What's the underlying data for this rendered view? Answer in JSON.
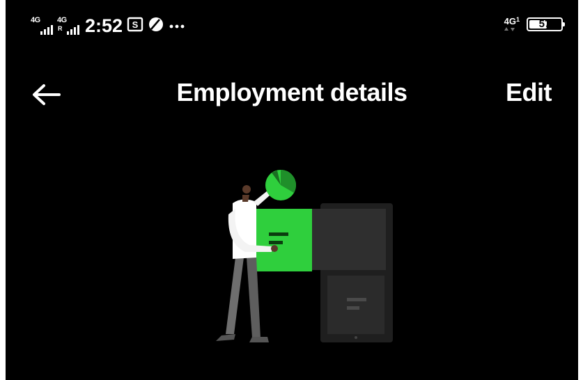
{
  "status_bar": {
    "sim1_tech": "4G",
    "sim2_tech": "4G",
    "sim2_roaming": "R",
    "time": "2:52",
    "icons": [
      "screenshot-icon",
      "leaf-icon",
      "more-dots-icon"
    ],
    "network_tech": "4G",
    "network_sub": "1",
    "battery_level": "57",
    "battery_fraction": 0.57
  },
  "app_bar": {
    "title": "Employment details",
    "edit_label": "Edit",
    "back_icon": "arrow-left-icon"
  },
  "illustration": {
    "name": "person-filing-documents-illustration",
    "colors": {
      "accent_green": "#2ecc40",
      "dark_cabinet": "#2b2b2b",
      "figure_shirt": "#ffffff",
      "figure_pants": "#6e6e6e"
    }
  },
  "colors": {
    "background": "#000000",
    "text": "#ffffff"
  }
}
